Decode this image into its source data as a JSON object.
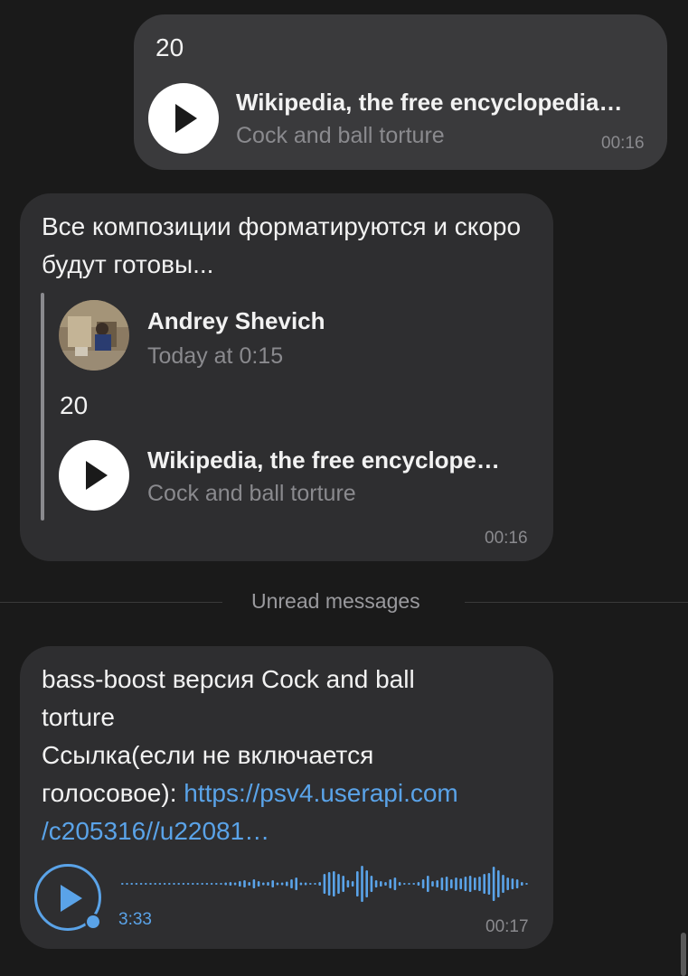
{
  "msg_out": {
    "text": "20",
    "audio_title": "Wikipedia, the free encyclopedia…",
    "audio_subtitle": "Cock and ball torture",
    "time": "00:16"
  },
  "msg_reply": {
    "text": "Все композиции форматируются и скоро будут готовы...",
    "quote": {
      "author": "Andrey Shevich",
      "date": "Today at 0:15",
      "text": "20",
      "audio_title": "Wikipedia, the free encyclope…",
      "audio_subtitle": "Cock and ball torture"
    },
    "time": "00:16"
  },
  "divider": {
    "label": "Unread messages"
  },
  "msg_voice": {
    "text_line1": "bass-boost версия Cock and ball",
    "text_line2": "torture",
    "text_line3": "Ссылка(если не включается",
    "text_line4_prefix": "голосовое): ",
    "link_line1": "https://psv4.userapi.com",
    "link_line2": "/c205316//u22081…",
    "duration": "3:33",
    "time": "00:17",
    "waveform": [
      2,
      2,
      2,
      2,
      2,
      2,
      2,
      2,
      2,
      2,
      2,
      2,
      2,
      2,
      2,
      2,
      2,
      2,
      2,
      2,
      2,
      2,
      3,
      4,
      3,
      6,
      8,
      4,
      10,
      6,
      3,
      4,
      8,
      3,
      3,
      5,
      10,
      14,
      3,
      3,
      2,
      2,
      4,
      22,
      26,
      28,
      22,
      18,
      8,
      6,
      28,
      40,
      30,
      18,
      8,
      6,
      4,
      10,
      14,
      4,
      2,
      2,
      2,
      4,
      10,
      18,
      6,
      8,
      14,
      16,
      10,
      14,
      12,
      16,
      18,
      14,
      16,
      22,
      24,
      38,
      30,
      20,
      14,
      12,
      10,
      4,
      2
    ]
  },
  "colors": {
    "accent": "#5aa3e8",
    "bubble": "#2e2e30",
    "bubble_out": "#3a3a3c",
    "bg": "#1a1a1a"
  },
  "icons": [
    "play-icon",
    "avatar-photo"
  ]
}
